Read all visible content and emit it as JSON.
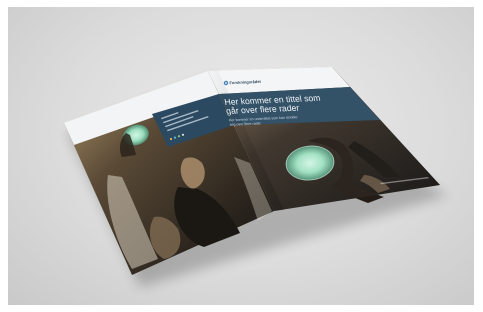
{
  "brochure": {
    "brand": "Forskningsrådet",
    "title_line1": "Her kommer en tittel som",
    "title_line2": "går over flere rader",
    "subtitle_line1": "Her kommer en undertittel som kan strekke",
    "subtitle_line2": "seg over flere rader"
  },
  "colors": {
    "background": "#d9d9d9",
    "paper": "#f4f5f6",
    "navy": "#2b4a61",
    "glow": "#a8e6c9"
  }
}
